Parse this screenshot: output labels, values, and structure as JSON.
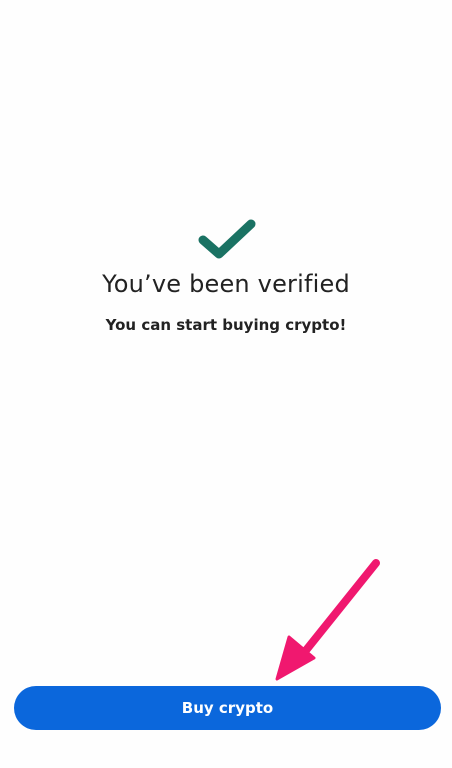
{
  "verification": {
    "icon": "checkmark-icon",
    "icon_color": "#1a7263",
    "title": "You’ve been verified",
    "subtitle": "You can start buying crypto!"
  },
  "action": {
    "button_label": "Buy crypto",
    "button_color": "#0b67dc"
  },
  "annotation": {
    "icon": "arrow-icon",
    "color": "#f0186f"
  }
}
